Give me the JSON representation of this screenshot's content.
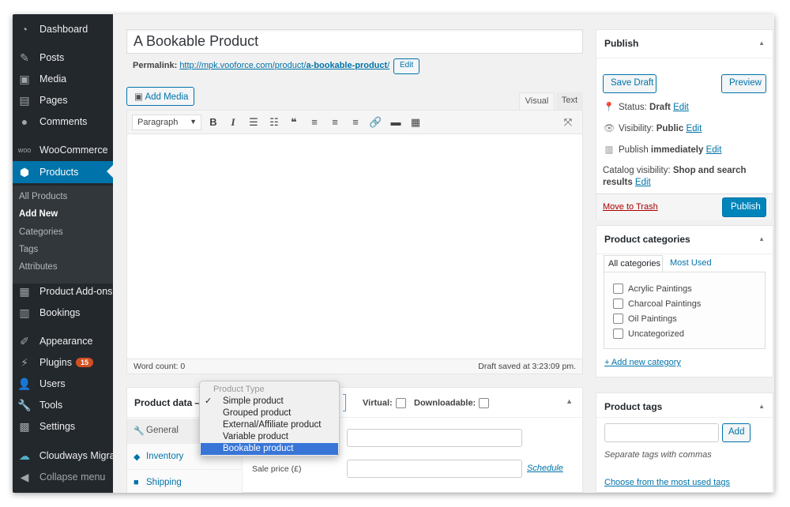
{
  "sidebar": {
    "items": [
      {
        "label": "Dashboard",
        "icon": "dashboard-icon"
      },
      {
        "label": "Posts",
        "icon": "pin-icon"
      },
      {
        "label": "Media",
        "icon": "media-icon"
      },
      {
        "label": "Pages",
        "icon": "page-icon"
      },
      {
        "label": "Comments",
        "icon": "comment-icon"
      },
      {
        "label": "WooCommerce",
        "icon": "woo-icon"
      },
      {
        "label": "Products",
        "icon": "box-icon"
      },
      {
        "label": "Product Add-ons",
        "icon": "grid-icon"
      },
      {
        "label": "Bookings",
        "icon": "calendar-icon"
      },
      {
        "label": "Appearance",
        "icon": "brush-icon"
      },
      {
        "label": "Plugins",
        "icon": "plug-icon",
        "badge": "15"
      },
      {
        "label": "Users",
        "icon": "user-icon"
      },
      {
        "label": "Tools",
        "icon": "wrench-icon"
      },
      {
        "label": "Settings",
        "icon": "settings-icon"
      },
      {
        "label": "Cloudways Migrate",
        "icon": "cloud-icon"
      },
      {
        "label": "Collapse menu",
        "icon": "collapse-icon"
      }
    ],
    "submenu": [
      "All Products",
      "Add New",
      "Categories",
      "Tags",
      "Attributes"
    ]
  },
  "editor": {
    "title": "A Bookable Product",
    "permalink_label": "Permalink:",
    "permalink_base": "http://mpk.vooforce.com/product/",
    "permalink_slug": "a-bookable-product",
    "permalink_tail": "/",
    "permalink_edit": "Edit",
    "add_media": "Add Media",
    "tab_visual": "Visual",
    "tab_text": "Text",
    "format": "Paragraph",
    "word_count": "Word count: 0",
    "draft_saved": "Draft saved at 3:23:09 pm."
  },
  "product_data": {
    "title": "Product data —",
    "virtual_label": "Virtual:",
    "downloadable_label": "Downloadable:",
    "tabs": [
      "General",
      "Inventory",
      "Shipping"
    ],
    "sale_price_label": "Sale price (£)",
    "schedule": "Schedule"
  },
  "dropdown": {
    "header": "Product Type",
    "options": [
      "Simple product",
      "Grouped product",
      "External/Affiliate product",
      "Variable product",
      "Bookable product"
    ],
    "checked": "Simple product",
    "highlighted": "Bookable product"
  },
  "publish": {
    "title": "Publish",
    "save_draft": "Save Draft",
    "preview": "Preview",
    "status_label": "Status:",
    "status_value": "Draft",
    "visibility_label": "Visibility:",
    "visibility_value": "Public",
    "publish_label": "Publish",
    "publish_value": "immediately",
    "catalog_label": "Catalog visibility:",
    "catalog_value": "Shop and search",
    "catalog_value2": "results",
    "edit": "Edit",
    "trash": "Move to Trash",
    "publish_button": "Publish"
  },
  "categories": {
    "title": "Product categories",
    "tab_all": "All categories",
    "tab_most": "Most Used",
    "items": [
      "Acrylic Paintings",
      "Charcoal Paintings",
      "Oil Paintings",
      "Uncategorized"
    ],
    "add_new": "+ Add new category"
  },
  "tags": {
    "title": "Product tags",
    "add": "Add",
    "hint": "Separate tags with commas",
    "choose": "Choose from the most used tags"
  },
  "colors": {
    "accent": "#0073aa",
    "sidebar": "#23282d",
    "highlight": "#3875d7",
    "primary_button": "#0085ba"
  }
}
